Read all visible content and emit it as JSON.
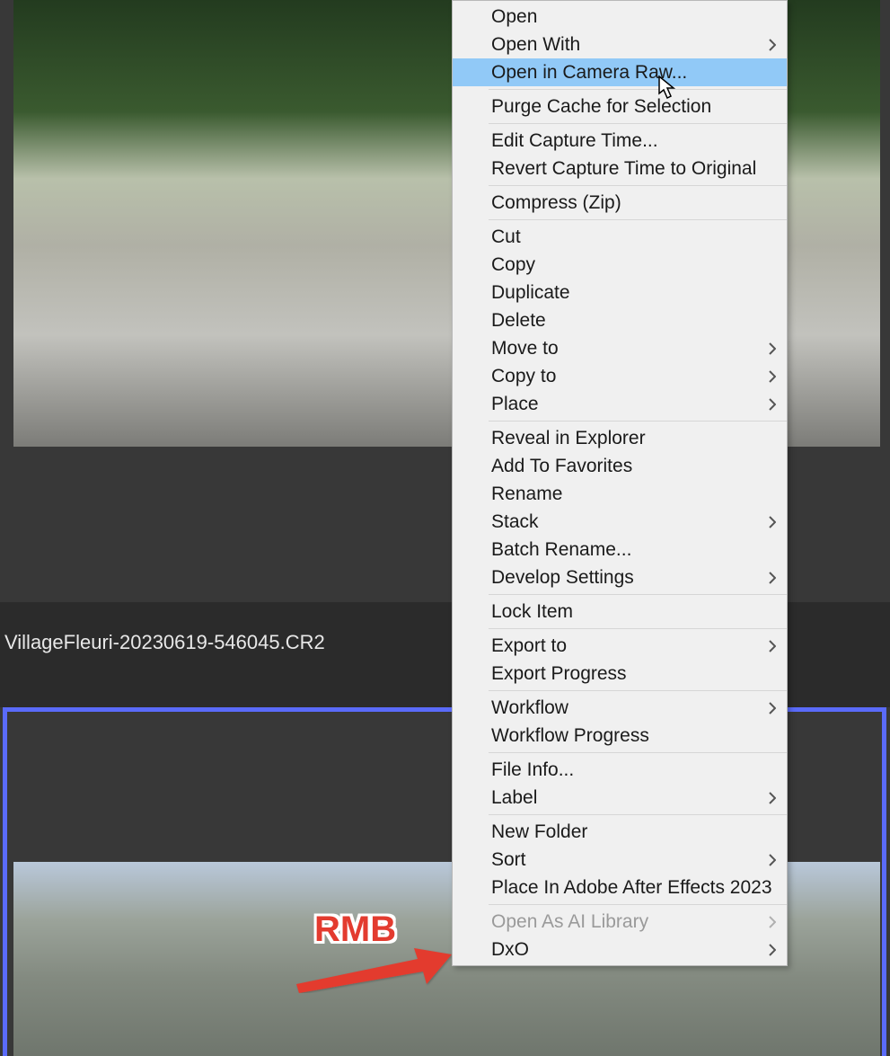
{
  "filename": "VillageFleuri-20230619-546045.CR2",
  "annotation_label": "RMB",
  "menu": {
    "groups": [
      [
        {
          "label": "Open",
          "submenu": false,
          "disabled": false,
          "highlight": false,
          "name": "menu-open"
        },
        {
          "label": "Open With",
          "submenu": true,
          "disabled": false,
          "highlight": false,
          "name": "menu-open-with"
        },
        {
          "label": "Open in Camera Raw...",
          "submenu": false,
          "disabled": false,
          "highlight": true,
          "name": "menu-open-camera-raw"
        }
      ],
      [
        {
          "label": "Purge Cache for Selection",
          "submenu": false,
          "disabled": false,
          "highlight": false,
          "name": "menu-purge-cache"
        }
      ],
      [
        {
          "label": "Edit Capture Time...",
          "submenu": false,
          "disabled": false,
          "highlight": false,
          "name": "menu-edit-capture-time"
        },
        {
          "label": "Revert Capture Time to Original",
          "submenu": false,
          "disabled": false,
          "highlight": false,
          "name": "menu-revert-capture-time"
        }
      ],
      [
        {
          "label": "Compress (Zip)",
          "submenu": false,
          "disabled": false,
          "highlight": false,
          "name": "menu-compress-zip"
        }
      ],
      [
        {
          "label": "Cut",
          "submenu": false,
          "disabled": false,
          "highlight": false,
          "name": "menu-cut"
        },
        {
          "label": "Copy",
          "submenu": false,
          "disabled": false,
          "highlight": false,
          "name": "menu-copy"
        },
        {
          "label": "Duplicate",
          "submenu": false,
          "disabled": false,
          "highlight": false,
          "name": "menu-duplicate"
        },
        {
          "label": "Delete",
          "submenu": false,
          "disabled": false,
          "highlight": false,
          "name": "menu-delete"
        },
        {
          "label": "Move to",
          "submenu": true,
          "disabled": false,
          "highlight": false,
          "name": "menu-move-to"
        },
        {
          "label": "Copy to",
          "submenu": true,
          "disabled": false,
          "highlight": false,
          "name": "menu-copy-to"
        },
        {
          "label": "Place",
          "submenu": true,
          "disabled": false,
          "highlight": false,
          "name": "menu-place"
        }
      ],
      [
        {
          "label": "Reveal in Explorer",
          "submenu": false,
          "disabled": false,
          "highlight": false,
          "name": "menu-reveal-explorer"
        },
        {
          "label": "Add To Favorites",
          "submenu": false,
          "disabled": false,
          "highlight": false,
          "name": "menu-add-favorites"
        },
        {
          "label": "Rename",
          "submenu": false,
          "disabled": false,
          "highlight": false,
          "name": "menu-rename"
        },
        {
          "label": "Stack",
          "submenu": true,
          "disabled": false,
          "highlight": false,
          "name": "menu-stack"
        },
        {
          "label": "Batch Rename...",
          "submenu": false,
          "disabled": false,
          "highlight": false,
          "name": "menu-batch-rename"
        },
        {
          "label": "Develop Settings",
          "submenu": true,
          "disabled": false,
          "highlight": false,
          "name": "menu-develop-settings"
        }
      ],
      [
        {
          "label": "Lock Item",
          "submenu": false,
          "disabled": false,
          "highlight": false,
          "name": "menu-lock-item"
        }
      ],
      [
        {
          "label": "Export to",
          "submenu": true,
          "disabled": false,
          "highlight": false,
          "name": "menu-export-to"
        },
        {
          "label": "Export Progress",
          "submenu": false,
          "disabled": false,
          "highlight": false,
          "name": "menu-export-progress"
        }
      ],
      [
        {
          "label": "Workflow",
          "submenu": true,
          "disabled": false,
          "highlight": false,
          "name": "menu-workflow"
        },
        {
          "label": "Workflow Progress",
          "submenu": false,
          "disabled": false,
          "highlight": false,
          "name": "menu-workflow-progress"
        }
      ],
      [
        {
          "label": "File Info...",
          "submenu": false,
          "disabled": false,
          "highlight": false,
          "name": "menu-file-info"
        },
        {
          "label": "Label",
          "submenu": true,
          "disabled": false,
          "highlight": false,
          "name": "menu-label"
        }
      ],
      [
        {
          "label": "New Folder",
          "submenu": false,
          "disabled": false,
          "highlight": false,
          "name": "menu-new-folder"
        },
        {
          "label": "Sort",
          "submenu": true,
          "disabled": false,
          "highlight": false,
          "name": "menu-sort"
        },
        {
          "label": "Place In Adobe After Effects 2023",
          "submenu": false,
          "disabled": false,
          "highlight": false,
          "name": "menu-place-ae"
        }
      ],
      [
        {
          "label": "Open As AI Library",
          "submenu": true,
          "disabled": true,
          "highlight": false,
          "name": "menu-open-ai-library"
        },
        {
          "label": "DxO",
          "submenu": true,
          "disabled": false,
          "highlight": false,
          "name": "menu-dxo"
        }
      ]
    ]
  }
}
